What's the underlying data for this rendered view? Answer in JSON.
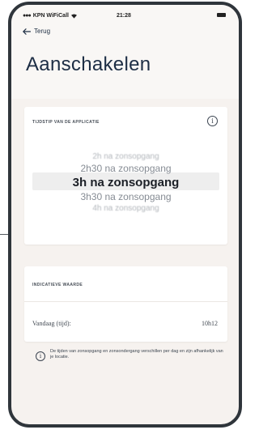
{
  "status_bar": {
    "carrier": "KPN WiFiCall",
    "time": "21:28"
  },
  "nav": {
    "back_label": "Terug"
  },
  "page": {
    "title": "Aanschakelen"
  },
  "time_card": {
    "label": "TIJDSTIP VAN DE APPLICATIE",
    "picker_options": [
      "2h na zonsopgang",
      "2h30 na zonsopgang",
      "3h na zonsopgang",
      "3h30 na zonsopgang",
      "4h na zonsopgang"
    ],
    "selected_index": 2
  },
  "indicative_card": {
    "label": "INDICATIEVE WAARDE",
    "row_label": "Vandaag (tijd):",
    "row_value": "10h12"
  },
  "note": {
    "text": "De tijden van zonsopgang en zonsondergang verschillen per dag en zijn afhankelijk van je locatie."
  },
  "colors": {
    "background": "#f6f2ef",
    "title": "#1d2e45",
    "frame": "#2f353b"
  },
  "icons": {
    "back": "arrow-left-icon",
    "info": "info-icon",
    "wifi": "wifi-icon",
    "battery": "battery-icon"
  }
}
